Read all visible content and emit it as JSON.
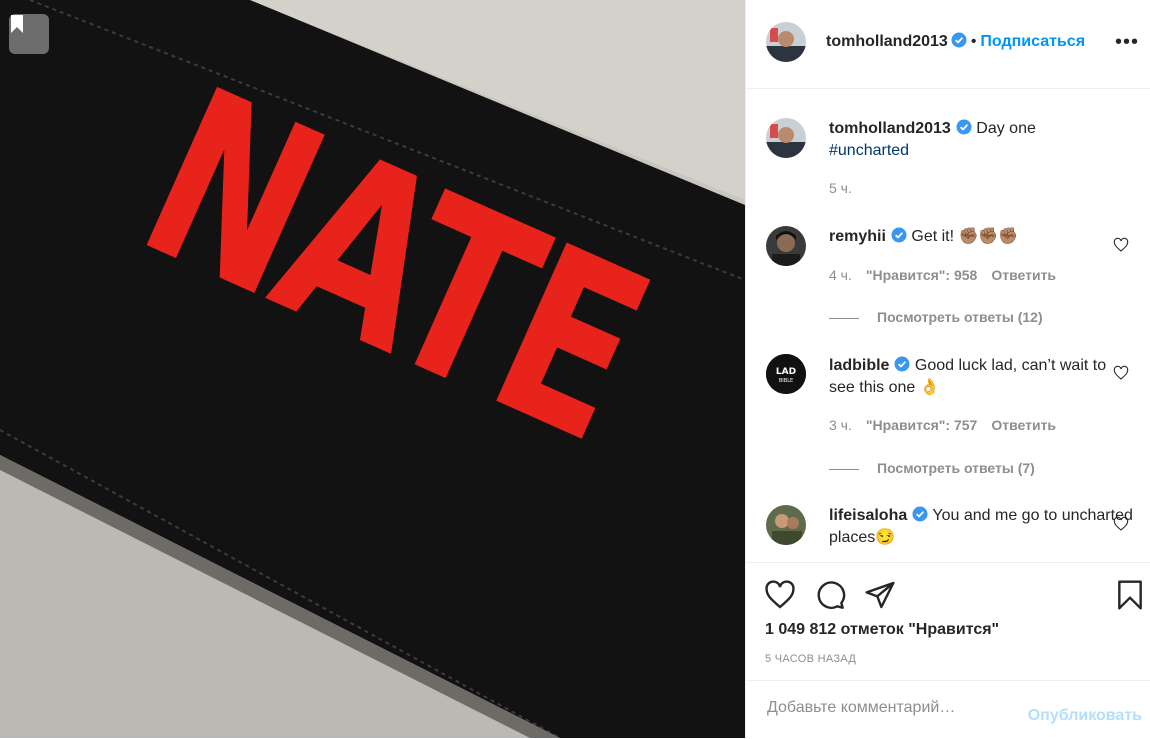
{
  "post": {
    "author": "tomholland2013",
    "follow_label": "Подписаться",
    "more_label": "•••",
    "separator": "•",
    "image_text": "NATE",
    "caption": {
      "username": "tomholland2013",
      "text": "Day one",
      "hashtag": "#uncharted",
      "age": "5 ч."
    }
  },
  "comments": [
    {
      "username": "remyhii",
      "text": "Get it! ",
      "emoji": "✊🏽✊🏽✊🏽",
      "age": "4 ч.",
      "likes": "\"Нравится\": 958",
      "reply": "Ответить",
      "view_replies": "Посмотреть ответы (12)"
    },
    {
      "username": "ladbible",
      "text": "Good luck lad, can’t wait to see this one ",
      "emoji": "👌",
      "avatar_text": "LAD",
      "avatar_sub": "BIBLE",
      "age": "3 ч.",
      "likes": "\"Нравится\": 757",
      "reply": "Ответить",
      "view_replies": "Посмотреть ответы (7)"
    },
    {
      "username": "lifeisaloha",
      "text": "You and me go to uncharted places",
      "emoji": "😏"
    }
  ],
  "likes_count": "1 049 812 отметок \"Нравится\"",
  "timestamp": "5 ЧАСОВ НАЗАД",
  "comment_input": {
    "placeholder": "Добавьте комментарий…"
  },
  "publish_label": "Опубликовать",
  "colors": {
    "accent": "#0095f6",
    "verified": "#3897f0",
    "logo_red": "#e8231c"
  }
}
